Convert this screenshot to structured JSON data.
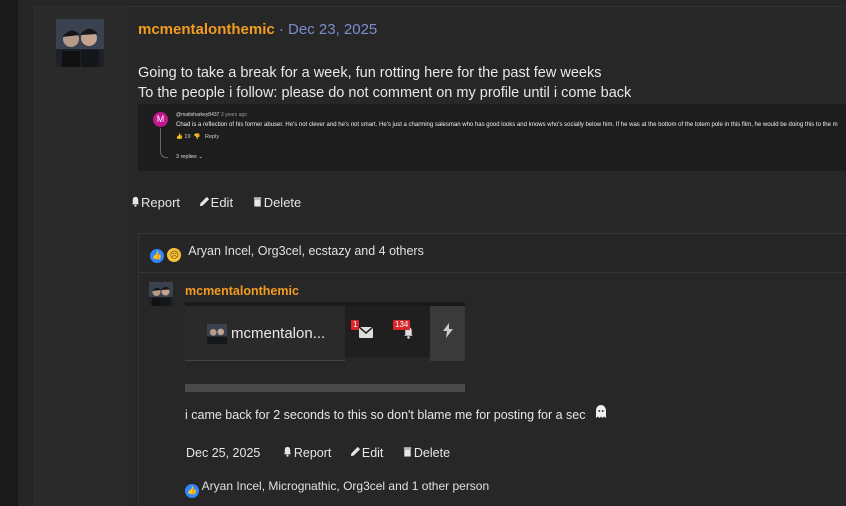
{
  "post": {
    "username": "mcmentalonthemic",
    "separator": "·",
    "date": "Dec 23, 2025",
    "message_lines": [
      "Going to take a break for a week, fun rotting here for the past few weeks",
      "To the people i follow: please do not comment on my profile until i come back"
    ],
    "embed": {
      "avatar_letter": "M",
      "handle": "@mattsharkey8437",
      "ago": "3 years ago",
      "comment": "Chad is a reflection of his former abuser. He's not clever and he's not smart. He's just a charming salesman who has good looks and knows who's socially below him. If he was at the bottom of the totem pole in this film, he would be doing this to the m",
      "likes": "19",
      "reply_label": "Reply",
      "replies": "3 replies"
    },
    "actions": {
      "report": "Report",
      "edit": "Edit",
      "delete": "Delete"
    },
    "reactions_text": "Aryan Incel, Org3cel, ecstazy and 4 others"
  },
  "comment": {
    "username": "mcmentalonthemic",
    "shot": {
      "name": "mcmentalon...",
      "mail_badge": "1",
      "alert_badge": "134"
    },
    "text": "i came back for 2 seconds to this so don't blame me for posting for a sec",
    "date": "Dec 25, 2025",
    "actions": {
      "report": "Report",
      "edit": "Edit",
      "delete": "Delete"
    },
    "reactions_text": "Aryan Incel, Micrognathic, Org3cel and 1 other person"
  },
  "colors": {
    "username": "#f39c1f",
    "date": "#7b8fd0",
    "like": "#2d88ff",
    "badge": "#d9262b"
  },
  "icons": [
    "bell-icon",
    "pencil-icon",
    "trash-icon",
    "like-icon",
    "sad-icon",
    "envelope-icon",
    "alert-icon",
    "bolt-icon",
    "ghost-icon"
  ]
}
